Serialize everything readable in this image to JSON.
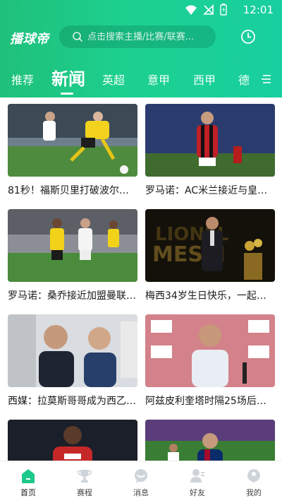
{
  "status_bar": {
    "time": "12:01"
  },
  "header": {
    "logo": "播球帝",
    "search_placeholder": "点击搜索主播/比赛/联赛..."
  },
  "tabs": [
    {
      "label": "推荐",
      "active": false
    },
    {
      "label": "新闻",
      "active": true
    },
    {
      "label": "英超",
      "active": false
    },
    {
      "label": "意甲",
      "active": false
    },
    {
      "label": "西甲",
      "active": false
    },
    {
      "label": "德",
      "active": false
    }
  ],
  "news": [
    {
      "title": "81秒！福斯贝里打破波尔…"
    },
    {
      "title": "罗马诺：AC米兰接近与皇…"
    },
    {
      "title": "罗马诺：桑乔接近加盟曼联…"
    },
    {
      "title": "梅西34岁生日快乐，一起…"
    },
    {
      "title": "西媒：拉莫斯哥哥成为西乙…"
    },
    {
      "title": "阿兹皮利奎塔时隔25场后…"
    },
    {
      "title": ""
    },
    {
      "title": ""
    }
  ],
  "bottom_nav": [
    {
      "label": "首页",
      "active": true
    },
    {
      "label": "赛程",
      "active": false
    },
    {
      "label": "消息",
      "active": false
    },
    {
      "label": "好友",
      "active": false
    },
    {
      "label": "我的",
      "active": false
    }
  ],
  "colors": {
    "brand_green": "#1dc98a",
    "nav_icon_gray": "#cfd4da"
  }
}
